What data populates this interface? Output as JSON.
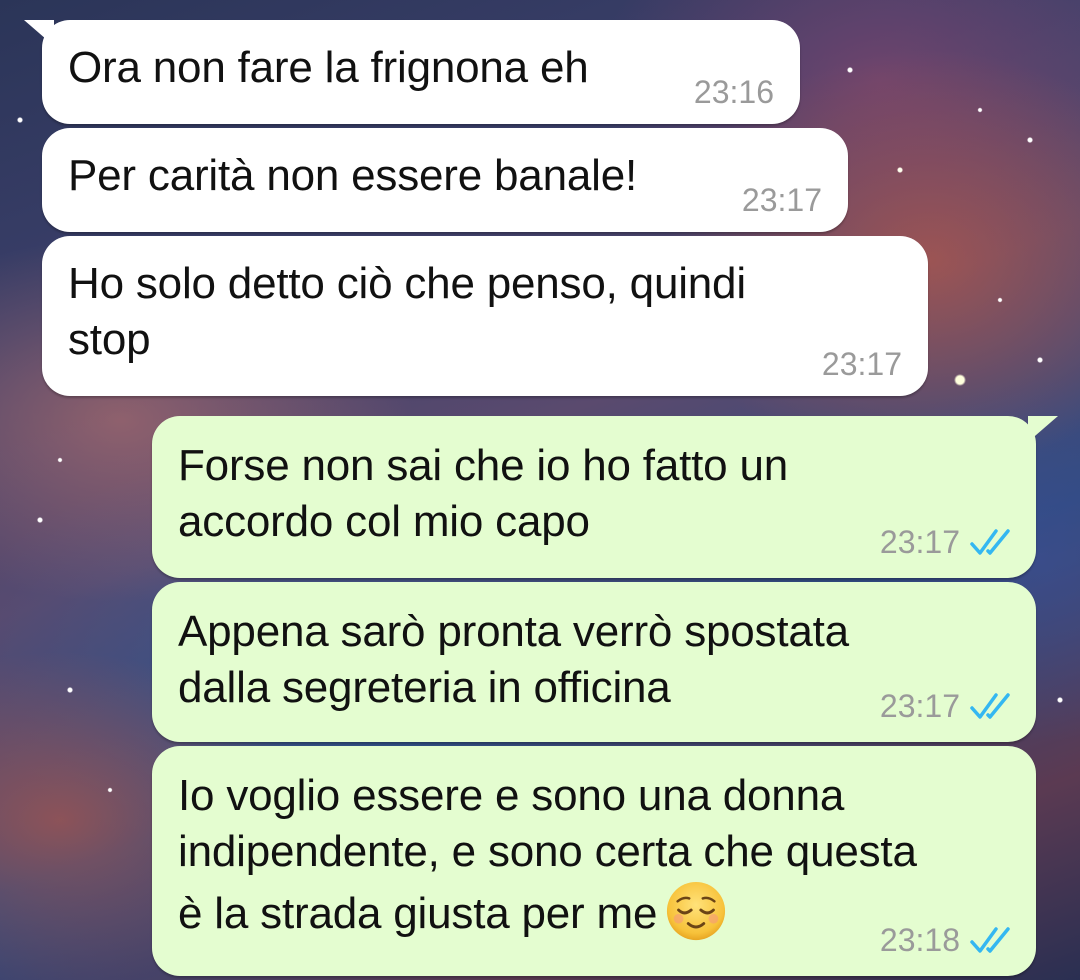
{
  "colors": {
    "incoming_bubble": "#ffffff",
    "outgoing_bubble": "#e4fdd0",
    "timestamp": "#9a9a9a",
    "read_ticks": "#34b7f1"
  },
  "messages": [
    {
      "direction": "incoming",
      "lines": [
        "Ora non fare la frignona eh"
      ],
      "time": "23:16"
    },
    {
      "direction": "incoming",
      "lines": [
        "Per carità non essere banale!"
      ],
      "time": "23:17"
    },
    {
      "direction": "incoming",
      "lines": [
        "Ho solo detto ciò che penso, quindi",
        "stop"
      ],
      "time": "23:17"
    },
    {
      "direction": "outgoing",
      "lines": [
        "Forse non sai che io ho fatto un",
        "accordo col mio capo"
      ],
      "time": "23:17",
      "status_icon": "double-check-read-icon"
    },
    {
      "direction": "outgoing",
      "lines": [
        "Appena sarò pronta verrò spostata",
        "dalla segreteria in officina"
      ],
      "time": "23:17",
      "status_icon": "double-check-read-icon"
    },
    {
      "direction": "outgoing",
      "lines": [
        "Io voglio essere e sono una donna",
        "indipendente, e sono certa che questa",
        "è la strada giusta per me"
      ],
      "time": "23:18",
      "status_icon": "double-check-read-icon",
      "emoji": "relieved-face-emoji"
    }
  ]
}
